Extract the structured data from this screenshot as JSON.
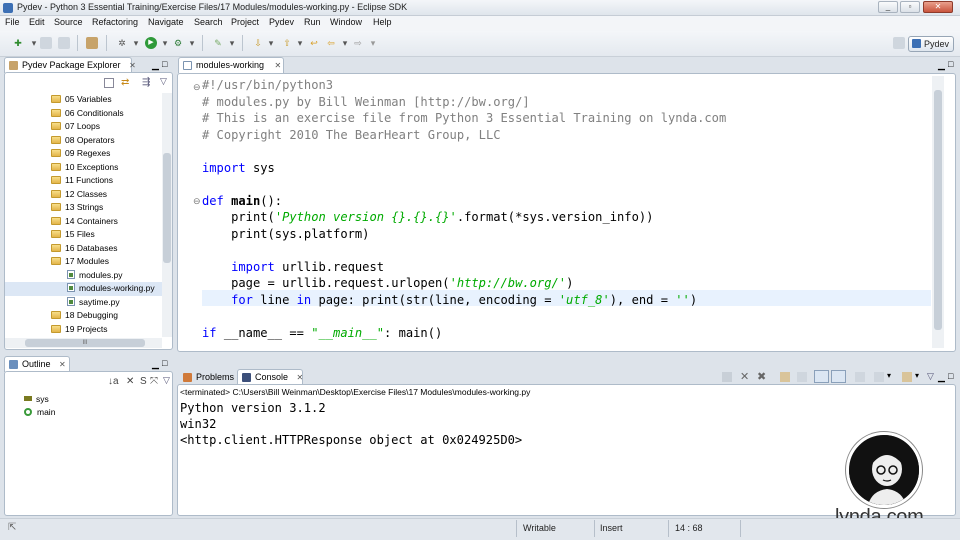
{
  "window": {
    "title": "Pydev - Python 3 Essential Training/Exercise Files/17 Modules/modules-working.py - Eclipse SDK",
    "minimize": "_",
    "restore": "▫",
    "close": "✕"
  },
  "menu": [
    "File",
    "Edit",
    "Source",
    "Refactoring",
    "Navigate",
    "Search",
    "Project",
    "Pydev",
    "Run",
    "Window",
    "Help"
  ],
  "perspective": {
    "label": "Pydev"
  },
  "package_explorer": {
    "title": "Pydev Package Explorer",
    "items": [
      {
        "label": "05 Variables",
        "type": "folder"
      },
      {
        "label": "06 Conditionals",
        "type": "folder"
      },
      {
        "label": "07 Loops",
        "type": "folder"
      },
      {
        "label": "08 Operators",
        "type": "folder"
      },
      {
        "label": "09 Regexes",
        "type": "folder"
      },
      {
        "label": "10 Exceptions",
        "type": "folder"
      },
      {
        "label": "11 Functions",
        "type": "folder"
      },
      {
        "label": "12 Classes",
        "type": "folder"
      },
      {
        "label": "13 Strings",
        "type": "folder"
      },
      {
        "label": "14 Containers",
        "type": "folder"
      },
      {
        "label": "15 Files",
        "type": "folder"
      },
      {
        "label": "16 Databases",
        "type": "folder"
      },
      {
        "label": "17 Modules",
        "type": "folder"
      },
      {
        "label": "modules.py",
        "type": "file"
      },
      {
        "label": "modules-working.py",
        "type": "file",
        "selected": true
      },
      {
        "label": "saytime.py",
        "type": "file"
      },
      {
        "label": "18 Debugging",
        "type": "folder"
      },
      {
        "label": "19 Projects",
        "type": "folder"
      }
    ],
    "hscroll": "III"
  },
  "outline": {
    "title": "Outline",
    "items": [
      {
        "label": "sys"
      },
      {
        "label": "main"
      }
    ]
  },
  "editor": {
    "tab": "modules-working",
    "lines": [
      {
        "parts": [
          {
            "t": "#!/usr/bin/python3",
            "c": "cmt"
          }
        ]
      },
      {
        "parts": [
          {
            "t": "# modules.py by Bill Weinman [http://bw.org/]",
            "c": "cmt"
          }
        ]
      },
      {
        "parts": [
          {
            "t": "# This is an exercise file from Python 3 Essential Training on lynda.com",
            "c": "cmt"
          }
        ]
      },
      {
        "parts": [
          {
            "t": "# Copyright 2010 The BearHeart Group, LLC",
            "c": "cmt"
          }
        ]
      },
      {
        "parts": []
      },
      {
        "parts": [
          {
            "t": "import",
            "c": "kw"
          },
          {
            "t": " sys",
            "c": "op"
          }
        ]
      },
      {
        "parts": []
      },
      {
        "parts": [
          {
            "t": "def",
            "c": "kw"
          },
          {
            "t": " ",
            "c": "op"
          },
          {
            "t": "main",
            "c": "fn"
          },
          {
            "t": "():",
            "c": "op"
          }
        ]
      },
      {
        "parts": [
          {
            "t": "    print(",
            "c": "op"
          },
          {
            "t": "'Python version {}.{}.{}'",
            "c": "str"
          },
          {
            "t": ".format(*sys.version_info))",
            "c": "op"
          }
        ]
      },
      {
        "parts": [
          {
            "t": "    print(sys.platform)",
            "c": "op"
          }
        ]
      },
      {
        "parts": []
      },
      {
        "parts": [
          {
            "t": "    ",
            "c": "op"
          },
          {
            "t": "import",
            "c": "kw"
          },
          {
            "t": " urllib.request",
            "c": "op"
          }
        ]
      },
      {
        "parts": [
          {
            "t": "    page = urllib.request.urlopen(",
            "c": "op"
          },
          {
            "t": "'http://bw.org/'",
            "c": "str"
          },
          {
            "t": ")",
            "c": "op"
          }
        ]
      },
      {
        "parts": [
          {
            "t": "    ",
            "c": "op"
          },
          {
            "t": "for",
            "c": "kw"
          },
          {
            "t": " line ",
            "c": "op"
          },
          {
            "t": "in",
            "c": "kw"
          },
          {
            "t": " page: print(str(line, encoding = ",
            "c": "op"
          },
          {
            "t": "'utf_8'",
            "c": "str"
          },
          {
            "t": "), end = ",
            "c": "op"
          },
          {
            "t": "''",
            "c": "str"
          },
          {
            "t": ")",
            "c": "op"
          }
        ],
        "highlight": true
      },
      {
        "parts": []
      },
      {
        "parts": [
          {
            "t": "if",
            "c": "kw"
          },
          {
            "t": " __name__ == ",
            "c": "op"
          },
          {
            "t": "\"__main__\"",
            "c": "str"
          },
          {
            "t": ": main()",
            "c": "op"
          }
        ]
      }
    ]
  },
  "bottom_tabs": {
    "problems": "Problems",
    "console": "Console"
  },
  "console": {
    "terminated": "<terminated> C:\\Users\\Bill Weinman\\Desktop\\Exercise Files\\17 Modules\\modules-working.py",
    "output": [
      "Python version 3.1.2",
      "win32",
      "<http.client.HTTPResponse object at 0x024925D0>"
    ]
  },
  "status": {
    "writable": "Writable",
    "insert": "Insert",
    "position": "14 : 68"
  },
  "watermark": {
    "text": "lynda.com"
  }
}
